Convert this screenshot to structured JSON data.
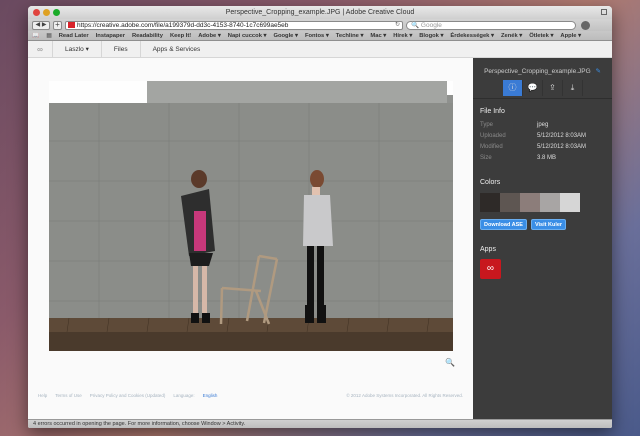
{
  "window": {
    "title": "Perspective_Cropping_example.JPG | Adobe Creative Cloud"
  },
  "toolbar": {
    "back_forward": "◀ ▶",
    "add_tab": "+",
    "url": "https://creative.adobe.com/file/a199379d-dd3c-4153-8740-1c7c699ae5eb",
    "search_placeholder": "Google"
  },
  "bookmarks": [
    "Read Later",
    "Instapaper",
    "Readability",
    "Keep It!",
    "Adobe ▾",
    "Napi cuccok ▾",
    "Google ▾",
    "Fontos ▾",
    "Techline ▾",
    "Mac ▾",
    "Hírek ▾",
    "Blogok ▾",
    "Érdekességek ▾",
    "Zenék ▾",
    "Ötletek ▾",
    "Apple ▾"
  ],
  "appnav": {
    "user": "Laszlo ▾",
    "files": "Files",
    "apps": "Apps & Services"
  },
  "sidebar": {
    "filename": "Perspective_Cropping_example.JPG",
    "file_info_heading": "File Info",
    "info": [
      {
        "key": "Type",
        "value": "jpeg"
      },
      {
        "key": "Uploaded",
        "value": "5/12/2012 8:03AM"
      },
      {
        "key": "Modified",
        "value": "5/12/2012 8:03AM"
      },
      {
        "key": "Size",
        "value": "3.8 MB"
      }
    ],
    "colors_heading": "Colors",
    "swatches": [
      "#2e2a28",
      "#5e5652",
      "#8c7d7a",
      "#a8a5a4",
      "#d6d6d6"
    ],
    "download_ase": "Download ASE",
    "visit_kuler": "Visit Kuler",
    "apps_heading": "Apps",
    "accent": "#3a8ee6"
  },
  "footer": {
    "help": "Help",
    "terms": "Terms of Use",
    "privacy": "Privacy Policy and Cookies (Updated)",
    "language_label": "Language:",
    "language": "English",
    "copyright": "© 2012 Adobe Systems Incorporated. All Rights Reserved."
  },
  "statusbar": {
    "text": "4 errors occurred in opening the page. For more information, choose Window > Activity."
  }
}
